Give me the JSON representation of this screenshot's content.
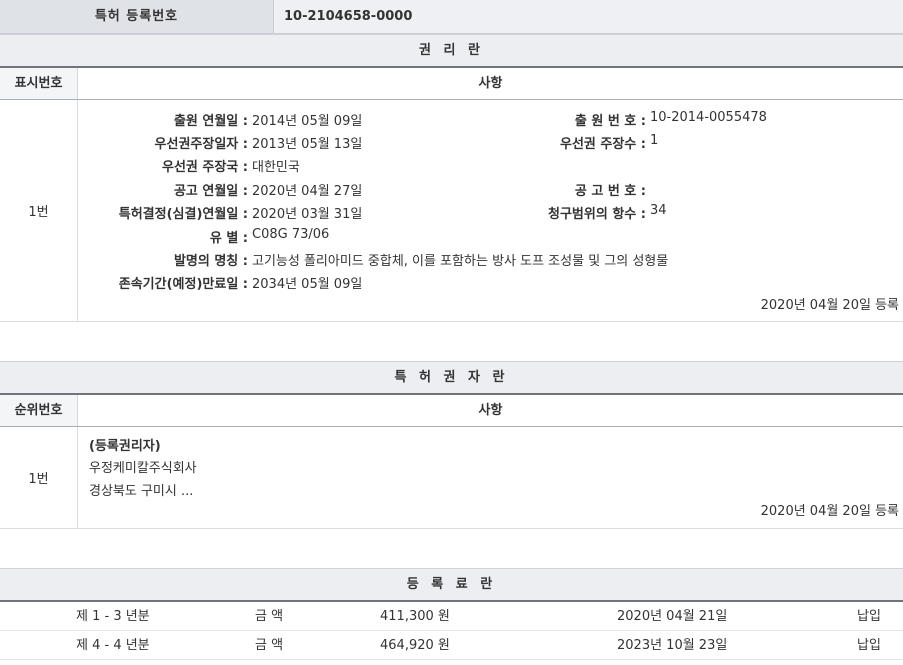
{
  "patent": {
    "label": "특허 등록번호",
    "number": "10-2104658-0000"
  },
  "rights": {
    "title": "권 리 란",
    "col_no": "표시번호",
    "col_item": "사항",
    "row_no": "1번",
    "filing_date_label": "출원 연월일 :",
    "filing_date": "2014년 05월 09일",
    "filing_no_label": "출 원 번 호 :",
    "filing_no": "10-2014-0055478",
    "priority_date_label": "우선권주장일자 :",
    "priority_date": "2013년 05월 13일",
    "priority_count_label": "우선권 주장수 :",
    "priority_count": "1",
    "priority_country_label": "우선권 주장국 :",
    "priority_country": "대한민국",
    "pub_date_label": "공고 연월일 :",
    "pub_date": "2020년 04월 27일",
    "pub_no_label": "공 고 번 호 :",
    "pub_no": "",
    "decision_date_label": "특허결정(심결)연월일 :",
    "decision_date": "2020년 03월 31일",
    "claims_label": "청구범위의 항수 :",
    "claims": "34",
    "class_label": "유 별 :",
    "class": "C08G 73/06",
    "invention_label": "발명의 명칭 :",
    "invention": "고기능성 폴리아미드 중합체, 이를 포함하는 방사 도프 조성물 및 그의 성형물",
    "expiry_label": "존속기간(예정)만료일 :",
    "expiry": "2034년 05월 09일",
    "registered": "2020년 04월 20일 등록"
  },
  "owners": {
    "title": "특 허 권 자 란",
    "col_no": "순위번호",
    "col_item": "사항",
    "row_no": "1번",
    "role": "(등록권리자)",
    "name": "우정케미칼주식회사",
    "address": "경상북도 구미시 ...",
    "registered": "2020년 04월 20일 등록"
  },
  "fees": {
    "title": "등 록 료 란",
    "rows": [
      {
        "period": "제 1 - 3 년분",
        "amount_label": "금 액",
        "amount": "411,300 원",
        "date": "2020년 04월 21일",
        "status": "납입"
      },
      {
        "period": "제 4 - 4 년분",
        "amount_label": "금 액",
        "amount": "464,920 원",
        "date": "2023년 10월 23일",
        "status": "납입"
      }
    ]
  }
}
